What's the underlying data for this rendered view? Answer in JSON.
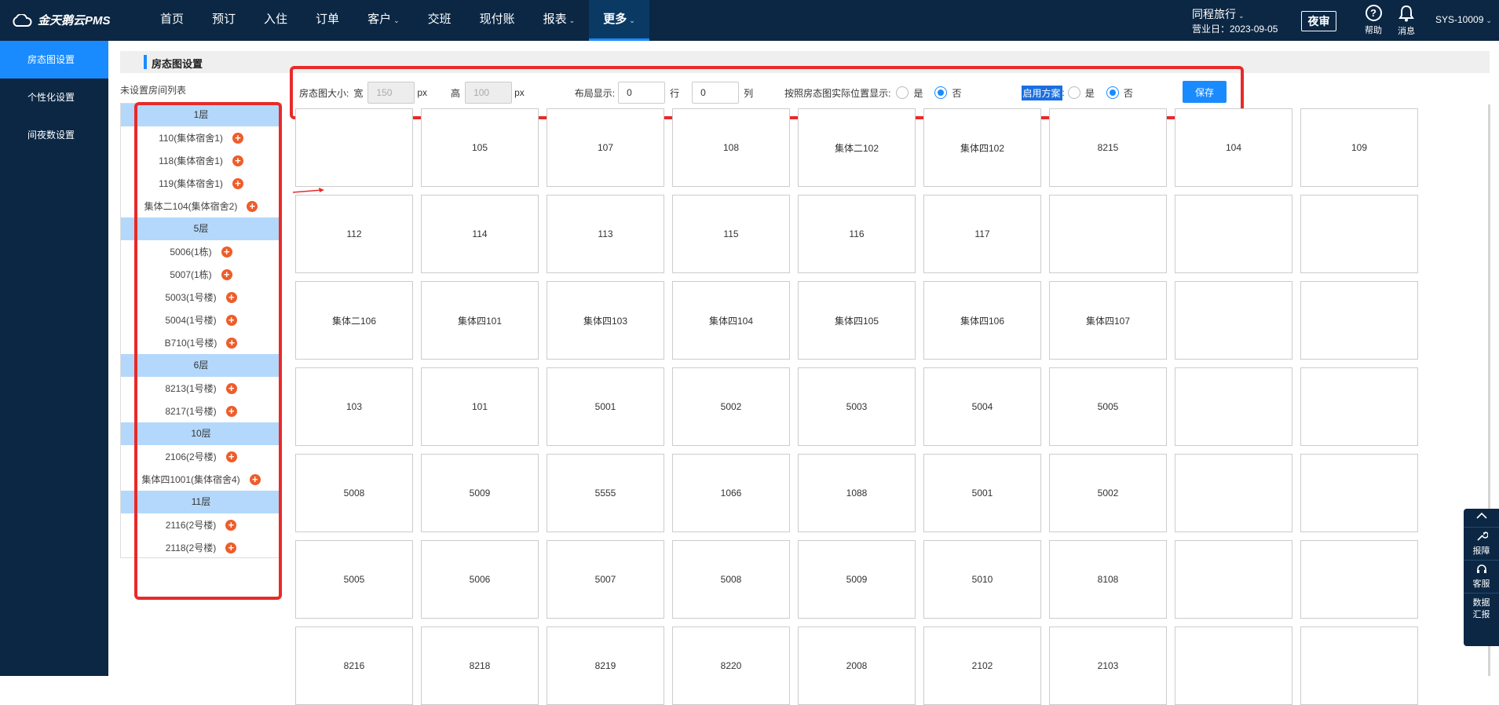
{
  "app": {
    "logo": "金天鹅云PMS"
  },
  "nav": [
    "首页",
    "预订",
    "入住",
    "订单",
    "客户",
    "交班",
    "现付账",
    "报表",
    "更多"
  ],
  "header": {
    "hotel": "同程旅行",
    "biz_date": "营业日：2023-09-05",
    "night_audit": "夜审",
    "help": "帮助",
    "messages": "消息",
    "user": "SYS-10009"
  },
  "sidebar": [
    "房态图设置",
    "个性化设置",
    "间夜数设置"
  ],
  "page": {
    "title": "房态图设置",
    "unset_label": "未设置房间列表"
  },
  "toolbar": {
    "size_label": "房态图大小:",
    "width_label": "宽",
    "width_value": "150",
    "px1": "px",
    "height_label": "高",
    "height_value": "100",
    "px2": "px",
    "layout_label": "布局显示:",
    "rows_value": "0",
    "rows_unit": "行",
    "cols_value": "0",
    "cols_unit": "列",
    "actual_pos_label": "按照房态图实际位置显示:",
    "yes": "是",
    "no": "否",
    "scheme_label": "启用方案",
    "scheme_colon": ":",
    "save": "保存"
  },
  "room_list": [
    {
      "floor": "1层",
      "rooms": [
        "110(集体宿舍1)",
        "118(集体宿舍1)",
        "119(集体宿舍1)",
        "集体二104(集体宿舍2)"
      ]
    },
    {
      "floor": "5层",
      "rooms": [
        "5006(1栋)",
        "5007(1栋)",
        "5003(1号楼)",
        "5004(1号楼)",
        "B710(1号楼)"
      ]
    },
    {
      "floor": "6层",
      "rooms": [
        "8213(1号楼)",
        "8217(1号楼)"
      ]
    },
    {
      "floor": "10层",
      "rooms": [
        "2106(2号楼)",
        "集体四1001(集体宿舍4)"
      ]
    },
    {
      "floor": "11层",
      "rooms": [
        "2116(2号楼)",
        "2118(2号楼)"
      ]
    }
  ],
  "grid": [
    "",
    "105",
    "107",
    "108",
    "集体二102",
    "集体四102",
    "8215",
    "104",
    "109",
    "112",
    "114",
    "113",
    "115",
    "116",
    "117",
    "",
    "",
    "",
    "集体二106",
    "集体四101",
    "集体四103",
    "集体四104",
    "集体四105",
    "集体四106",
    "集体四107",
    "",
    "",
    "103",
    "101",
    "5001",
    "5002",
    "5003",
    "5004",
    "5005",
    "",
    "",
    "5008",
    "5009",
    "5555",
    "1066",
    "1088",
    "5001",
    "5002",
    "",
    "",
    "5005",
    "5006",
    "5007",
    "5008",
    "5009",
    "5010",
    "8108",
    "",
    "",
    "8216",
    "8218",
    "8219",
    "8220",
    "2008",
    "2102",
    "2103",
    "",
    ""
  ],
  "right_panel": [
    "报障",
    "客服",
    "数据汇报"
  ]
}
